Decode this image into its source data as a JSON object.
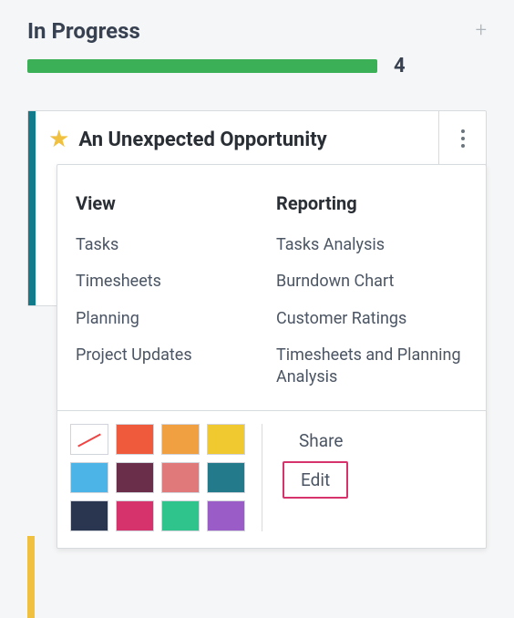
{
  "column": {
    "title": "In Progress",
    "count": "4"
  },
  "card": {
    "title": "An Unexpected Opportunity"
  },
  "dropdown": {
    "view": {
      "heading": "View",
      "items": [
        "Tasks",
        "Timesheets",
        "Planning",
        "Project Updates"
      ]
    },
    "reporting": {
      "heading": "Reporting",
      "items": [
        "Tasks Analysis",
        "Burndown Chart",
        "Customer Ratings",
        "Timesheets and Planning Analysis"
      ]
    },
    "colors": [
      "none",
      "#f05a3c",
      "#f0a040",
      "#f0c830",
      "#4cb4e6",
      "#6a2e4a",
      "#e07a7a",
      "#237a8a",
      "#2a3550",
      "#d6336c",
      "#2ec48c",
      "#9a5cc6"
    ],
    "actions": {
      "share": "Share",
      "edit": "Edit"
    }
  }
}
